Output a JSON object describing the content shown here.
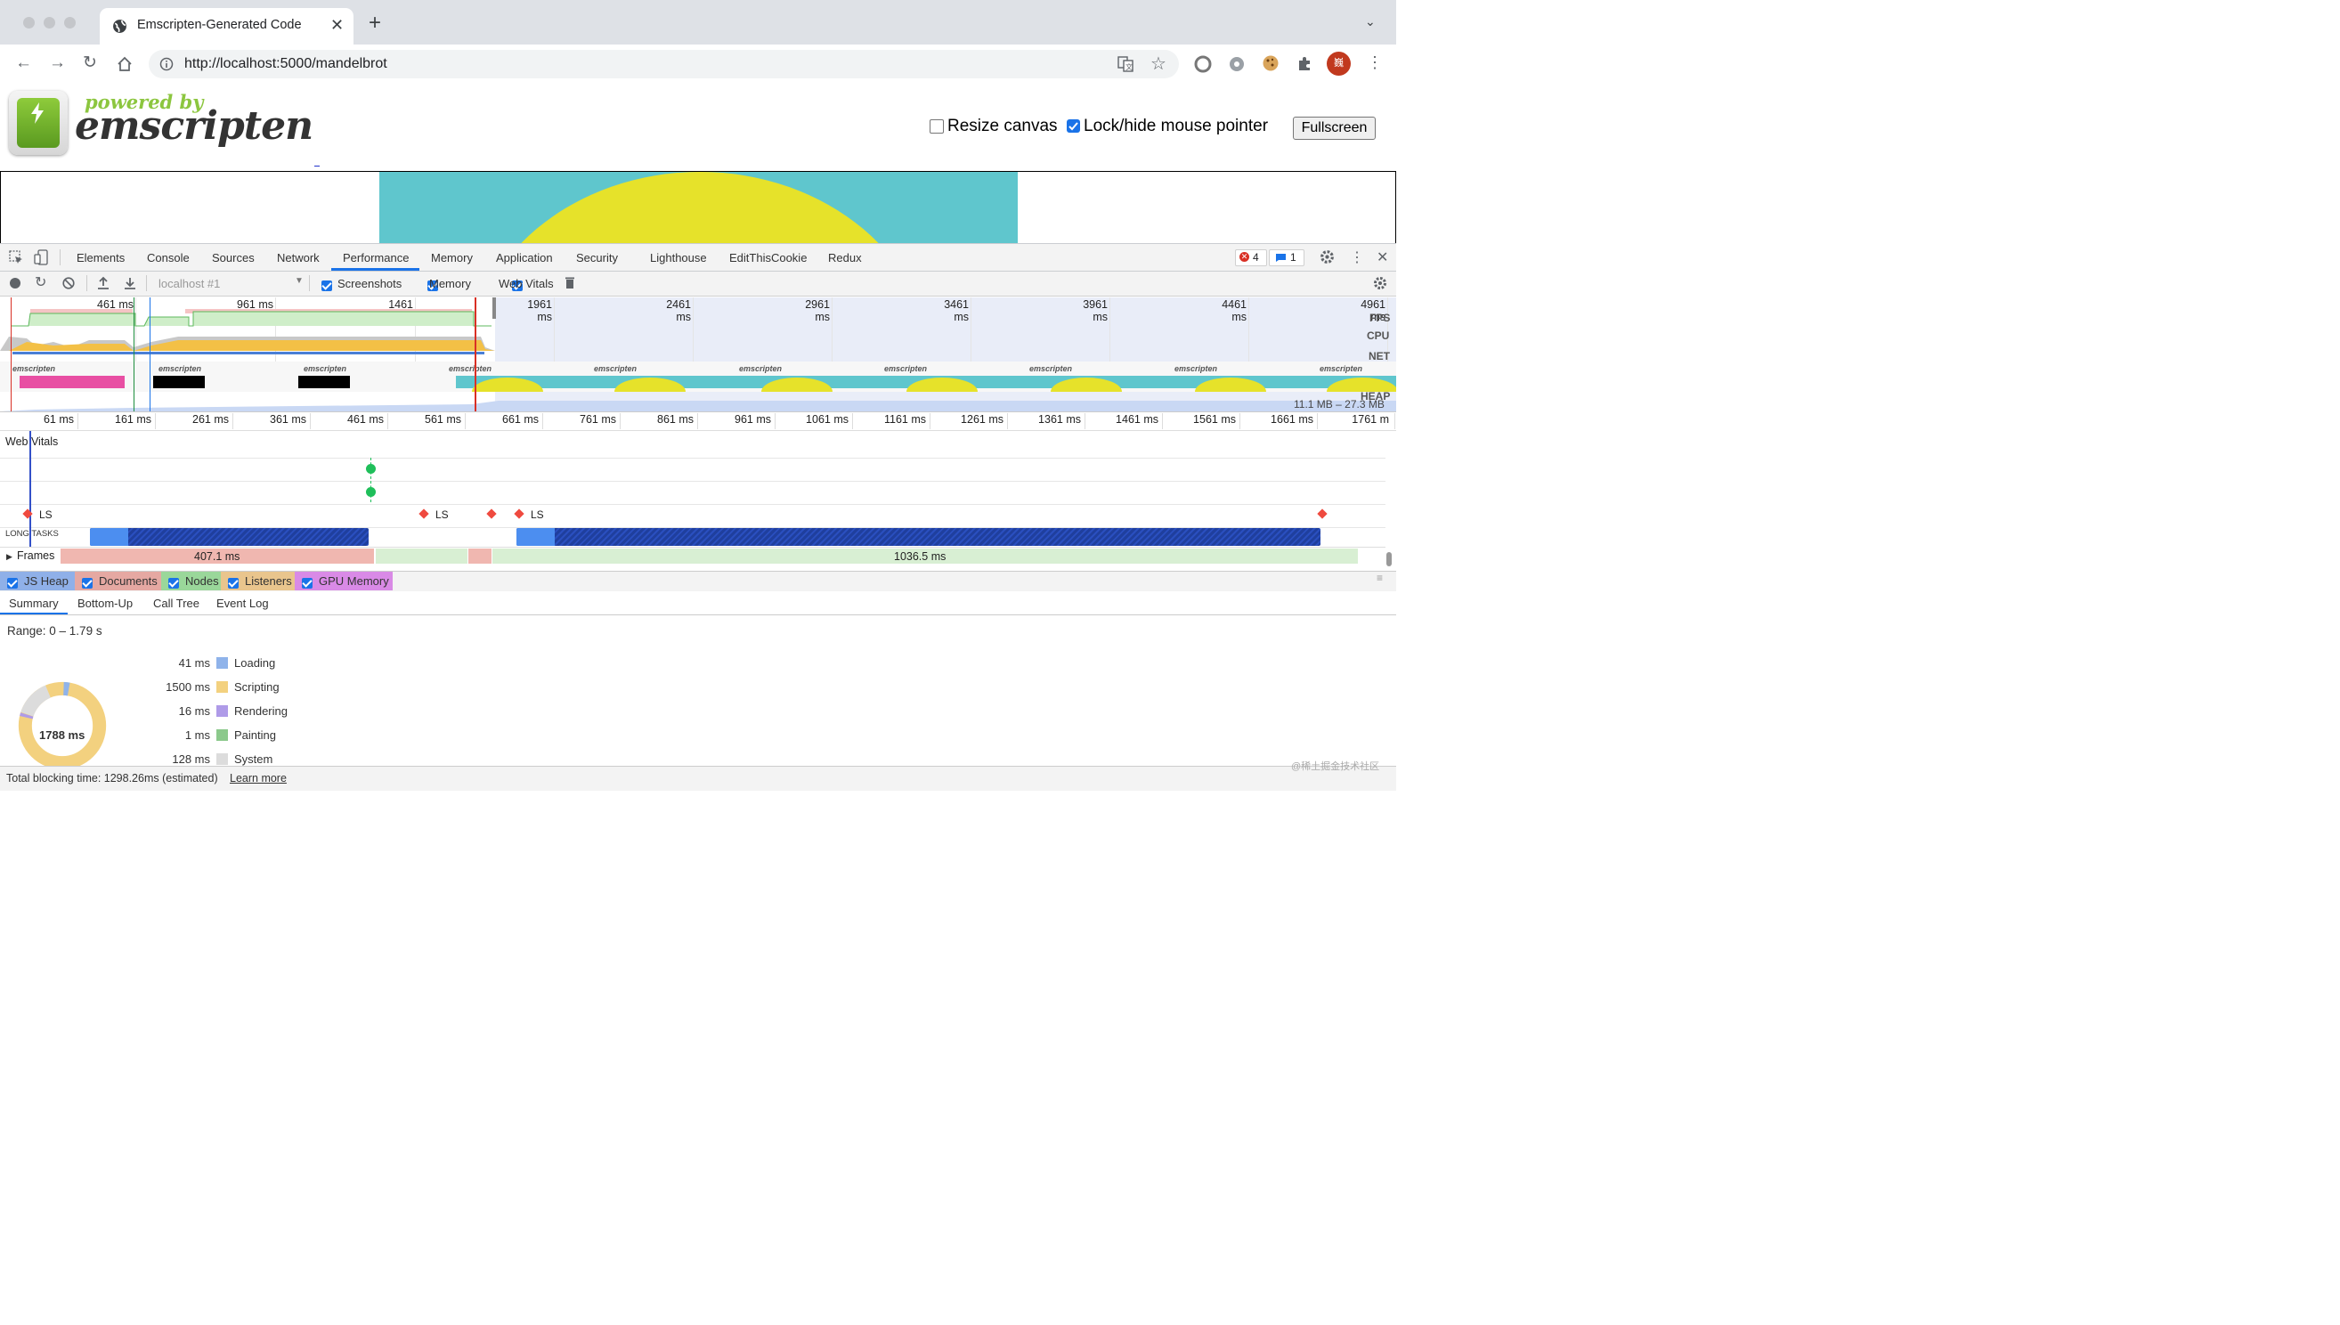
{
  "browser": {
    "tab_title": "Emscripten-Generated Code",
    "new_tab": "+",
    "url_host": "http://localhost:5000",
    "url_path": "/mandelbrot",
    "profile_initial": "巍"
  },
  "page": {
    "logo_top": "powered by",
    "logo_main": "emscripten",
    "resize_label": "Resize canvas",
    "lock_label": "Lock/hide mouse pointer",
    "fullscreen_label": "Fullscreen"
  },
  "devtools": {
    "tabs": [
      "Elements",
      "Console",
      "Sources",
      "Network",
      "Performance",
      "Memory",
      "Application",
      "Security",
      "Lighthouse",
      "EditThisCookie",
      "Redux"
    ],
    "active_tab": "Performance",
    "error_count": "4",
    "message_count": "1",
    "target": "localhost #1",
    "checkbox_screenshots": "Screenshots",
    "checkbox_memory": "Memory",
    "checkbox_webvitals": "Web Vitals",
    "overview_ticks": [
      "461 ms",
      "961 ms",
      "1461 ms",
      "1961 ms",
      "2461 ms",
      "2961 ms",
      "3461 ms",
      "3961 ms",
      "4461 ms",
      "4961 ms"
    ],
    "overview_labels": [
      "FPS",
      "CPU",
      "NET",
      "HEAP"
    ],
    "heap_range": "11.1 MB – 27.3 MB",
    "main_ticks": [
      "61 ms",
      "161 ms",
      "261 ms",
      "361 ms",
      "461 ms",
      "561 ms",
      "661 ms",
      "761 ms",
      "861 ms",
      "961 ms",
      "1061 ms",
      "1161 ms",
      "1261 ms",
      "1361 ms",
      "1461 ms",
      "1561 ms",
      "1661 ms",
      "1761 m"
    ],
    "web_vitals_label": "Web Vitals",
    "ls_label": "LS",
    "long_tasks_label": "LONG TASKS",
    "frames_label": "Frames",
    "frame_1": "407.1 ms",
    "frame_2": "1036.5 ms",
    "memory_checks": [
      "JS Heap",
      "Documents",
      "Nodes",
      "Listeners",
      "GPU Memory"
    ],
    "memory_colors": [
      "#8fb0e8",
      "#e5a8a2",
      "#9ad79a",
      "#e9c58d",
      "#d98ae6"
    ],
    "bottom_tabs": [
      "Summary",
      "Bottom-Up",
      "Call Tree",
      "Event Log"
    ],
    "range": "Range: 0 – 1.79 s",
    "summary": [
      {
        "time": "41 ms",
        "label": "Loading",
        "color": "#8fb3ea"
      },
      {
        "time": "1500 ms",
        "label": "Scripting",
        "color": "#f3d17f"
      },
      {
        "time": "16 ms",
        "label": "Rendering",
        "color": "#af9be8"
      },
      {
        "time": "1 ms",
        "label": "Painting",
        "color": "#8cc98c"
      },
      {
        "time": "128 ms",
        "label": "System",
        "color": "#dcdcdc"
      }
    ],
    "donut_total": "1788 ms",
    "status_text": "Total blocking time: 1298.26ms (estimated)",
    "learn_more": "Learn more",
    "watermark": "@稀土掘金技术社区"
  }
}
